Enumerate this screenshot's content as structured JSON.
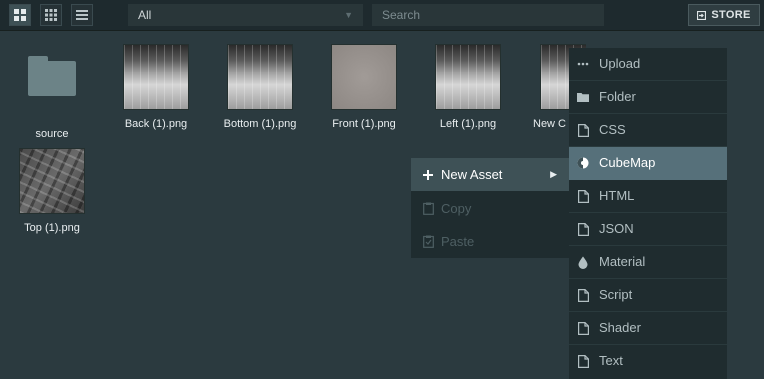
{
  "toolbar": {
    "view_buttons": [
      {
        "icon": "grid-large-icon",
        "active": true
      },
      {
        "icon": "grid-small-icon",
        "active": false
      },
      {
        "icon": "list-icon",
        "active": false
      }
    ],
    "filter": {
      "value": "All"
    },
    "search": {
      "placeholder": "Search"
    },
    "store_label": "STORE"
  },
  "assets": [
    {
      "name": "source",
      "kind": "folder"
    },
    {
      "name": "Back (1).png",
      "kind": "image"
    },
    {
      "name": "Bottom (1).png",
      "kind": "image"
    },
    {
      "name": "Front (1).png",
      "kind": "image"
    },
    {
      "name": "Left (1).png",
      "kind": "image"
    },
    {
      "name": "New C",
      "kind": "image"
    },
    {
      "name": "Top (1).png",
      "kind": "image"
    }
  ],
  "context_menu": {
    "items": [
      {
        "label": "New Asset",
        "icon": "plus-icon",
        "state": "active",
        "submenu": true
      },
      {
        "label": "Copy",
        "icon": "copy-icon",
        "state": "disabled"
      },
      {
        "label": "Paste",
        "icon": "paste-icon",
        "state": "disabled"
      }
    ]
  },
  "submenu": {
    "items": [
      {
        "label": "Upload",
        "icon": "ellipsis-icon"
      },
      {
        "label": "Folder",
        "icon": "folder-icon"
      },
      {
        "label": "CSS",
        "icon": "file-icon"
      },
      {
        "label": "CubeMap",
        "icon": "cubemap-icon",
        "state": "active"
      },
      {
        "label": "HTML",
        "icon": "file-icon"
      },
      {
        "label": "JSON",
        "icon": "file-icon"
      },
      {
        "label": "Material",
        "icon": "droplet-icon"
      },
      {
        "label": "Script",
        "icon": "file-icon"
      },
      {
        "label": "Shader",
        "icon": "file-icon"
      },
      {
        "label": "Text",
        "icon": "file-icon"
      }
    ]
  },
  "colors": {
    "background": "#2b3a3f",
    "toolbar": "#1e2a2e",
    "menu": "#1f2c2f",
    "submenu_active": "#56707a",
    "menu_active": "#3e5156"
  }
}
